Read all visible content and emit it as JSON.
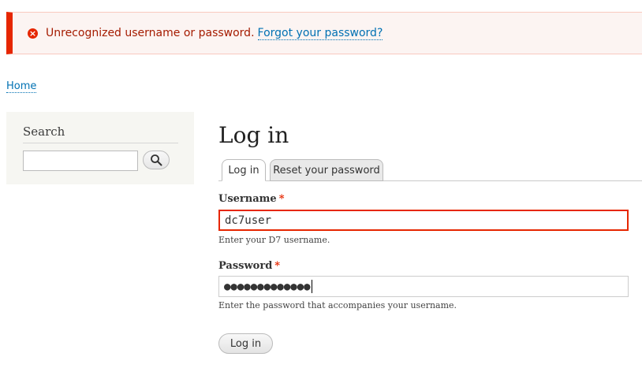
{
  "message": {
    "text": "Unrecognized username or password.",
    "link": "Forgot your password?",
    "icon": "error-icon"
  },
  "breadcrumb": {
    "home": "Home"
  },
  "sidebar": {
    "title": "Search",
    "search_value": "",
    "search_icon": "magnifier-icon"
  },
  "page": {
    "title": "Log in"
  },
  "tabs": [
    {
      "label": "Log in",
      "active": true
    },
    {
      "label": "Reset your password",
      "active": false
    }
  ],
  "form": {
    "username_label": "Username",
    "required_mark": "*",
    "username_value": "dc7user",
    "username_desc": "Enter your D7 username.",
    "password_label": "Password",
    "password_value": "●●●●●●●●●●●●●",
    "password_desc": "Enter the password that accompanies your username.",
    "submit_label": "Log in"
  },
  "colors": {
    "error": "#e62600",
    "link": "#0071b3",
    "sidebar_bg": "#f6f6f2"
  }
}
